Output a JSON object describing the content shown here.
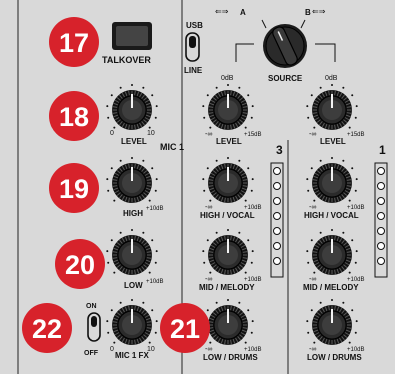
{
  "callouts": [
    {
      "id": "17",
      "label": "17"
    },
    {
      "id": "18",
      "label": "18"
    },
    {
      "id": "19",
      "label": "19"
    },
    {
      "id": "20",
      "label": "20"
    },
    {
      "id": "21",
      "label": "21"
    },
    {
      "id": "22",
      "label": "22"
    }
  ],
  "mic1_on_talkover": {
    "top": "MIC 1 ON",
    "bottom": "TALKOVER"
  },
  "usb_line": {
    "top": "USB",
    "bottom": "LINE"
  },
  "source": {
    "label": "SOURCE",
    "a": "A",
    "b": "B",
    "usb_symbol_left": "⇐⇒",
    "usb_symbol_right": "⇐⇒"
  },
  "channel_labels": {
    "mic": "MIC 1",
    "ch3": "3",
    "ch1": "1"
  },
  "mic1_fx_switch": {
    "on": "ON",
    "off": "OFF"
  },
  "knob_labels": {
    "level": "LEVEL",
    "high": "HIGH",
    "low": "LOW",
    "mic1_fx": "MIC 1 FX",
    "high_vocal": "HIGH / VOCAL",
    "mid_melody": "MID / MELODY",
    "low_drums": "LOW / DRUMS"
  },
  "scale": {
    "zero": "0",
    "ten": "10",
    "zero_db": "0dB",
    "neg_inf": "-∞",
    "plus15": "+15dB",
    "plus10": "+10dB"
  },
  "colors": {
    "callout": "#d7222b",
    "panel": "#d9d9d9",
    "ink": "#111111"
  }
}
